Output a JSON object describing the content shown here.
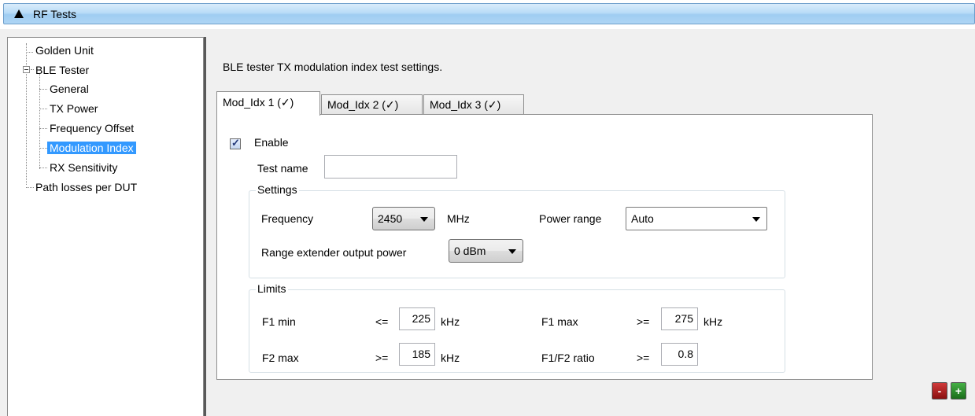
{
  "header": {
    "title": "RF Tests"
  },
  "tree": {
    "items": [
      {
        "label": "Golden Unit"
      },
      {
        "label": "BLE Tester"
      },
      {
        "label": "General"
      },
      {
        "label": "TX Power"
      },
      {
        "label": "Frequency Offset"
      },
      {
        "label": "Modulation Index"
      },
      {
        "label": "RX Sensitivity"
      },
      {
        "label": "Path losses per DUT"
      }
    ]
  },
  "main": {
    "description": "BLE tester TX modulation index test settings.",
    "tabs": [
      {
        "label": "Mod_Idx 1 (✓)"
      },
      {
        "label": "Mod_Idx 2 (✓)"
      },
      {
        "label": "Mod_Idx 3 (✓)"
      }
    ],
    "enable_label": "Enable",
    "enable_checked": true,
    "test_name_label": "Test name",
    "test_name_value": "",
    "settings": {
      "title": "Settings",
      "frequency_label": "Frequency",
      "frequency_value": "2450",
      "frequency_unit": "MHz",
      "power_range_label": "Power range",
      "power_range_value": "Auto",
      "range_ext_label": "Range extender output power",
      "range_ext_value": "0 dBm"
    },
    "limits": {
      "title": "Limits",
      "f1min_label": "F1 min",
      "f1min_op": "<=",
      "f1min_value": "225",
      "f1min_unit": "kHz",
      "f1max_label": "F1 max",
      "f1max_op": ">=",
      "f1max_value": "275",
      "f1max_unit": "kHz",
      "f2max_label": "F2 max",
      "f2max_op": ">=",
      "f2max_value": "185",
      "f2max_unit": "kHz",
      "ratio_label": "F1/F2 ratio",
      "ratio_op": ">=",
      "ratio_value": "0.8"
    }
  },
  "buttons": {
    "remove": "-",
    "add": "+"
  },
  "colors": {
    "selection": "#3399ff",
    "remove": "#b22222",
    "add": "#2e8b2e"
  }
}
